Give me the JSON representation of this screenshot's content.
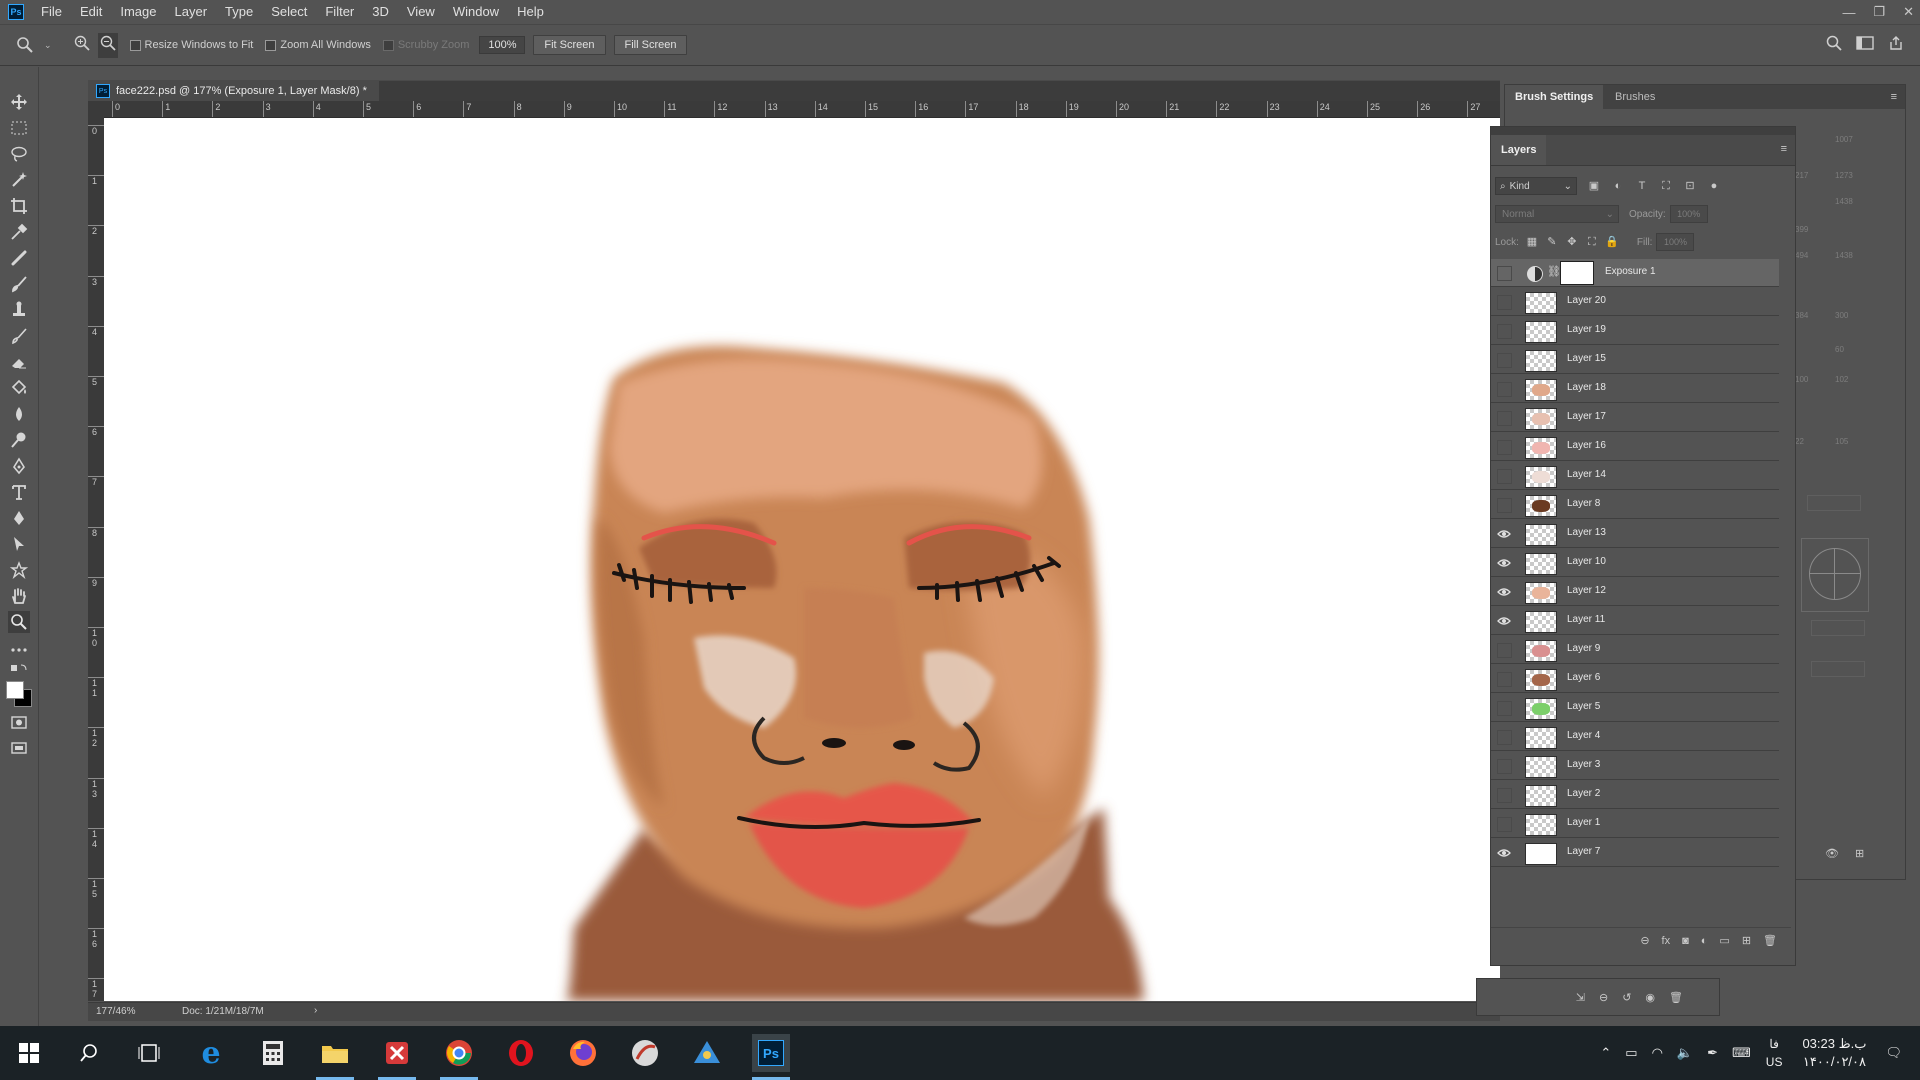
{
  "app": {
    "logo": "Ps",
    "menu": [
      "File",
      "Edit",
      "Image",
      "Layer",
      "Type",
      "Select",
      "Filter",
      "3D",
      "View",
      "Window",
      "Help"
    ],
    "window_controls": [
      "—",
      "❐",
      "✕"
    ]
  },
  "options_bar": {
    "tool_icon": "zoom-icon",
    "resize_windows": "Resize Windows to Fit",
    "zoom_all_windows": "Zoom All Windows",
    "scrubby_zoom": "Scrubby Zoom",
    "zoom_value": "100%",
    "fit_screen": "Fit Screen",
    "fill_screen": "Fill Screen"
  },
  "document": {
    "title": "face222.psd @ 177% (Exposure 1, Layer Mask/8) *",
    "status_zoom": "177/46%",
    "status_doc": "Doc: 1/21M/18/7M",
    "ruler_h": [
      "0",
      "1",
      "2",
      "3",
      "4",
      "5",
      "6",
      "7",
      "8",
      "9",
      "10",
      "11",
      "12",
      "13",
      "14",
      "15",
      "16",
      "17",
      "18",
      "19",
      "20",
      "21",
      "22",
      "23",
      "24",
      "25",
      "26",
      "27"
    ],
    "ruler_v": [
      "0",
      "1",
      "2",
      "3",
      "4",
      "5",
      "6",
      "7",
      "8",
      "9",
      "1\n0",
      "1\n1",
      "1\n2",
      "1\n3",
      "1\n4",
      "1\n5",
      "1\n6",
      "1\n7"
    ]
  },
  "brush_panel": {
    "tabs": [
      "Brush Settings",
      "Brushes"
    ],
    "grid_numbers": [
      "1007",
      "217",
      "1273",
      "1438",
      "399",
      "494",
      "1438",
      "384",
      "300",
      "60",
      "100",
      "102",
      "22",
      "105"
    ]
  },
  "layers_panel": {
    "tab": "Layers",
    "kind": "Kind",
    "blend_mode": "Normal",
    "opacity_label": "Opacity:",
    "opacity_value": "100%",
    "lock_label": "Lock:",
    "fill_label": "Fill:",
    "fill_value": "100%",
    "layers": [
      {
        "name": "Exposure 1",
        "visible": false,
        "selected": true,
        "type": "adjustment"
      },
      {
        "name": "Layer 20",
        "visible": false
      },
      {
        "name": "Layer 19",
        "visible": false
      },
      {
        "name": "Layer 15",
        "visible": false
      },
      {
        "name": "Layer 18",
        "visible": false
      },
      {
        "name": "Layer 17",
        "visible": false
      },
      {
        "name": "Layer 16",
        "visible": false
      },
      {
        "name": "Layer 14",
        "visible": false
      },
      {
        "name": "Layer 8",
        "visible": false
      },
      {
        "name": "Layer 13",
        "visible": true
      },
      {
        "name": "Layer 10",
        "visible": true
      },
      {
        "name": "Layer 12",
        "visible": true
      },
      {
        "name": "Layer 11",
        "visible": true
      },
      {
        "name": "Layer 9",
        "visible": false
      },
      {
        "name": "Layer 6",
        "visible": false
      },
      {
        "name": "Layer 5",
        "visible": false
      },
      {
        "name": "Layer 4",
        "visible": false
      },
      {
        "name": "Layer 3",
        "visible": false
      },
      {
        "name": "Layer 2",
        "visible": false
      },
      {
        "name": "Layer 1",
        "visible": false
      },
      {
        "name": "Layer 7",
        "visible": true
      }
    ],
    "footer_icons": [
      "link-icon",
      "fx-icon",
      "mask-icon",
      "adjustment-icon",
      "group-icon",
      "new-layer-icon",
      "trash-icon"
    ]
  },
  "taskbar": {
    "apps": [
      "start-icon",
      "search-icon",
      "task-view-icon",
      "edge-icon",
      "calculator-icon",
      "file-explorer-icon",
      "app-red-icon",
      "chrome-icon",
      "opera-icon",
      "firefox-icon",
      "app-circle-icon",
      "app-blue-icon",
      "photoshop-icon"
    ],
    "lang_top": "فا",
    "lang_bottom": "US",
    "time": "03:23 ب.ظ",
    "date": "۱۴۰۰/۰۲/۰۸"
  },
  "colors": {
    "ui_bg": "#535353",
    "canvas": "#ffffff",
    "skin_light": "#e3a57f",
    "skin_mid": "#c98555",
    "skin_dark": "#9a5a3a",
    "lip": "#e6564a",
    "eyeshadow": "#a9643e",
    "accent": "#31a8ff"
  }
}
